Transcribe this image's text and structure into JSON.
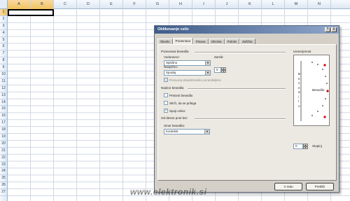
{
  "sheet": {
    "columns": [
      "A",
      "B",
      "C",
      "D",
      "E",
      "F",
      "G",
      "H",
      "I",
      "J",
      "K",
      "L",
      "M",
      "N"
    ],
    "selected_columns": [
      "A",
      "B"
    ],
    "rows": [
      "1",
      "2",
      "3",
      "4",
      "5",
      "6",
      "7",
      "8",
      "9",
      "10",
      "11",
      "12",
      "13",
      "14",
      "15",
      "16",
      "17",
      "18",
      "19",
      "20",
      "21",
      "22",
      "23",
      "24",
      "25",
      "26",
      "27"
    ],
    "selected_row": "1"
  },
  "dialog": {
    "title": "Oblikovanje celic",
    "help_label": "?",
    "close_label": "X",
    "tabs": [
      "Število",
      "Poravnava",
      "Pisava",
      "Obroba",
      "Polnilo",
      "Zaščita"
    ],
    "active_tab": "Poravnava",
    "text_alignment": {
      "section_title": "Poravnava besedila",
      "horizontal_label": "Vodoravno:",
      "horizontal_value": "Splošno",
      "vertical_label": "Navpično:",
      "vertical_value": "Spodaj",
      "indent_label": "Zamik:",
      "indent_value": "0",
      "justify_distributed_label": "Poravnaj obojestransko porazdeljeno"
    },
    "text_control": {
      "section_title": "Nadzor besedila",
      "wrap_label": "Prelomi besedilo",
      "shrink_label": "Skrči, da se prilega",
      "merge_label": "Spoji celice",
      "wrap_checked": false,
      "shrink_checked": false,
      "merge_checked": true
    },
    "rtl": {
      "section_title": "Od desne proti levi",
      "direction_label": "Smer besedila:",
      "direction_value": "Kontekst"
    },
    "orientation": {
      "section_title": "Usmerjenost",
      "vertical_text_letters": [
        "B",
        "e",
        "s",
        "e",
        "d",
        "i",
        "l",
        "o"
      ],
      "rotated_text": "Besedilo",
      "degrees_value": "0",
      "degrees_label": "Stopinj"
    },
    "ok_label": "V redu",
    "cancel_label": "Prekliči"
  },
  "watermark": "www.elektronik.si",
  "colors": {
    "titlebar_start": "#3f5c8a",
    "titlebar_end": "#8fa6c9",
    "dialog_bg": "#d4d0c8",
    "header_bg": "#dde7f3",
    "selected_header": "#f1c15f",
    "orientation_marker": "#cc0000"
  }
}
